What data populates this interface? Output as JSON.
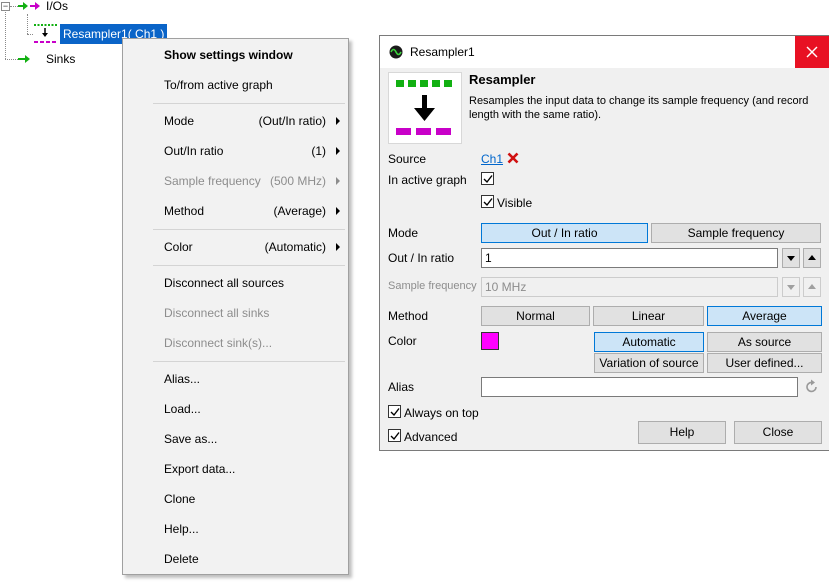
{
  "tree": {
    "root_expander": "−",
    "ios_label": "I/Os",
    "resampler_label": "Resampler1( Ch1 )",
    "sinks_label": "Sinks"
  },
  "menu": {
    "show_settings": "Show settings window",
    "to_from_graph": "To/from active graph",
    "mode": {
      "label": "Mode",
      "value": "(Out/In ratio)"
    },
    "ratio": {
      "label": "Out/In ratio",
      "value": "(1)"
    },
    "samplefreq": {
      "label": "Sample frequency",
      "value": "(500 MHz)"
    },
    "method": {
      "label": "Method",
      "value": "(Average)"
    },
    "color": {
      "label": "Color",
      "value": "(Automatic)"
    },
    "disconnect_sources": "Disconnect all sources",
    "disconnect_sinks": "Disconnect all sinks",
    "disconnect_sink": "Disconnect sink(s)...",
    "alias": "Alias...",
    "load": "Load...",
    "saveas": "Save as...",
    "export": "Export data...",
    "clone": "Clone",
    "help": "Help...",
    "delete": "Delete"
  },
  "dialog": {
    "title": "Resampler1",
    "heading": "Resampler",
    "description": "Resamples the input data to change its sample frequency (and record length with the same ratio).",
    "source_label": "Source",
    "source_value": "Ch1",
    "in_active_graph_label": "In active graph",
    "visible_label": "Visible",
    "mode_label": "Mode",
    "mode_options": [
      "Out / In ratio",
      "Sample frequency"
    ],
    "ratio_label": "Out / In ratio",
    "ratio_value": "1",
    "samplefreq_label": "Sample frequency",
    "samplefreq_value": "10 MHz",
    "method_label": "Method",
    "method_options": [
      "Normal",
      "Linear",
      "Average"
    ],
    "color_label": "Color",
    "color_swatch": "#ff00ff",
    "color_options": [
      "Automatic",
      "As source",
      "Variation of source",
      "User defined..."
    ],
    "alias_label": "Alias",
    "alias_value": "",
    "always_on_top_label": "Always on top",
    "advanced_label": "Advanced",
    "help_button": "Help",
    "close_button": "Close"
  },
  "colors": {
    "selection": "#0a64c8",
    "close_red": "#e81123",
    "toggle_on": "#cce4f7",
    "icon_green": "#12b012",
    "icon_magenta": "#c800c8"
  }
}
